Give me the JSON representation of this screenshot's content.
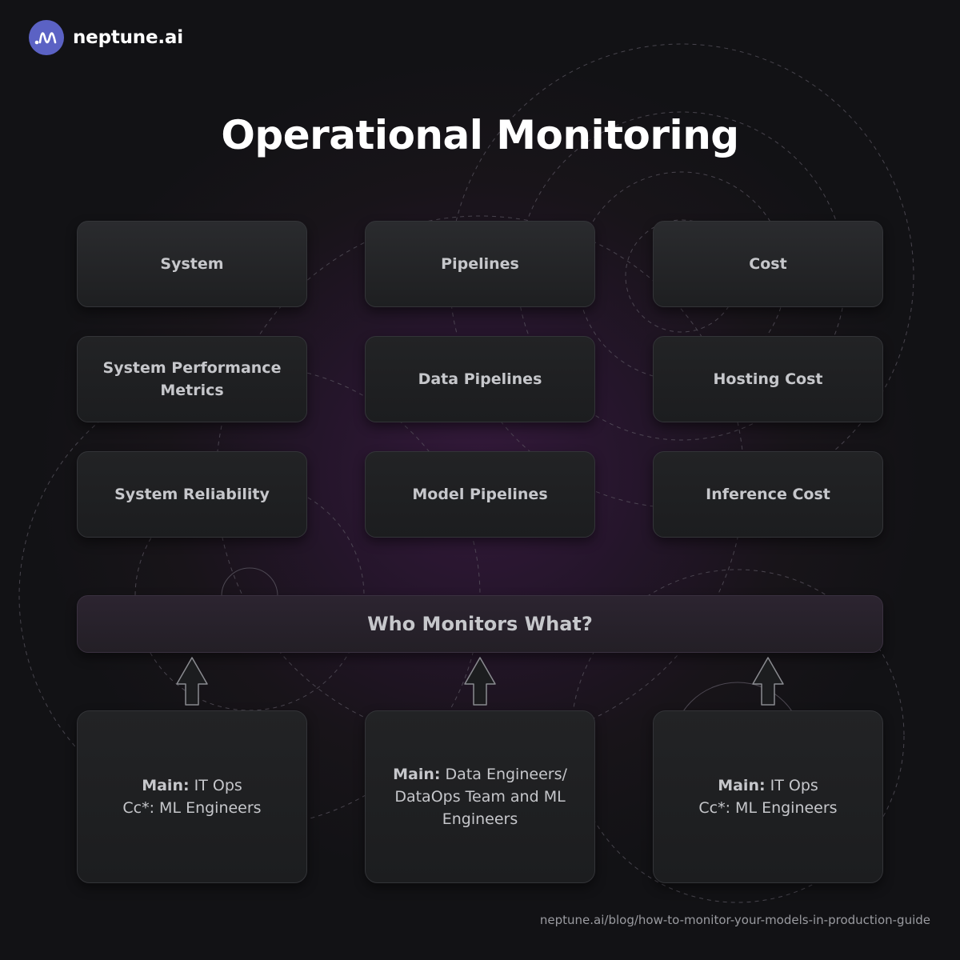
{
  "brand": {
    "name": "neptune.ai",
    "logo_icon": "wave-icon",
    "logo_color": "#5b62c4"
  },
  "title": "Operational Monitoring",
  "columns": [
    {
      "header": "System",
      "items": [
        "System Performance Metrics",
        "System Reliability"
      ],
      "owner": {
        "main_label": "Main:",
        "main_value": "IT Ops",
        "cc_line": "Cc*: ML Engineers"
      }
    },
    {
      "header": "Pipelines",
      "items": [
        "Data Pipelines",
        "Model Pipelines"
      ],
      "owner": {
        "main_label": "Main:",
        "main_value": "Data Engineers/ DataOps Team and ML Engineers",
        "cc_line": ""
      }
    },
    {
      "header": "Cost",
      "items": [
        "Hosting Cost",
        "Inference Cost"
      ],
      "owner": {
        "main_label": "Main:",
        "main_value": "IT Ops",
        "cc_line": "Cc*: ML Engineers"
      }
    }
  ],
  "banner": "Who Monitors What?",
  "arrow_icon": "arrow-up-icon",
  "footer_url": "neptune.ai/blog/how-to-monitor-your-models-in-production-guide",
  "colors": {
    "background": "#121215",
    "glow": "#33193a",
    "card": "#232426",
    "text": "#c6c7cb",
    "title": "#ffffff"
  }
}
